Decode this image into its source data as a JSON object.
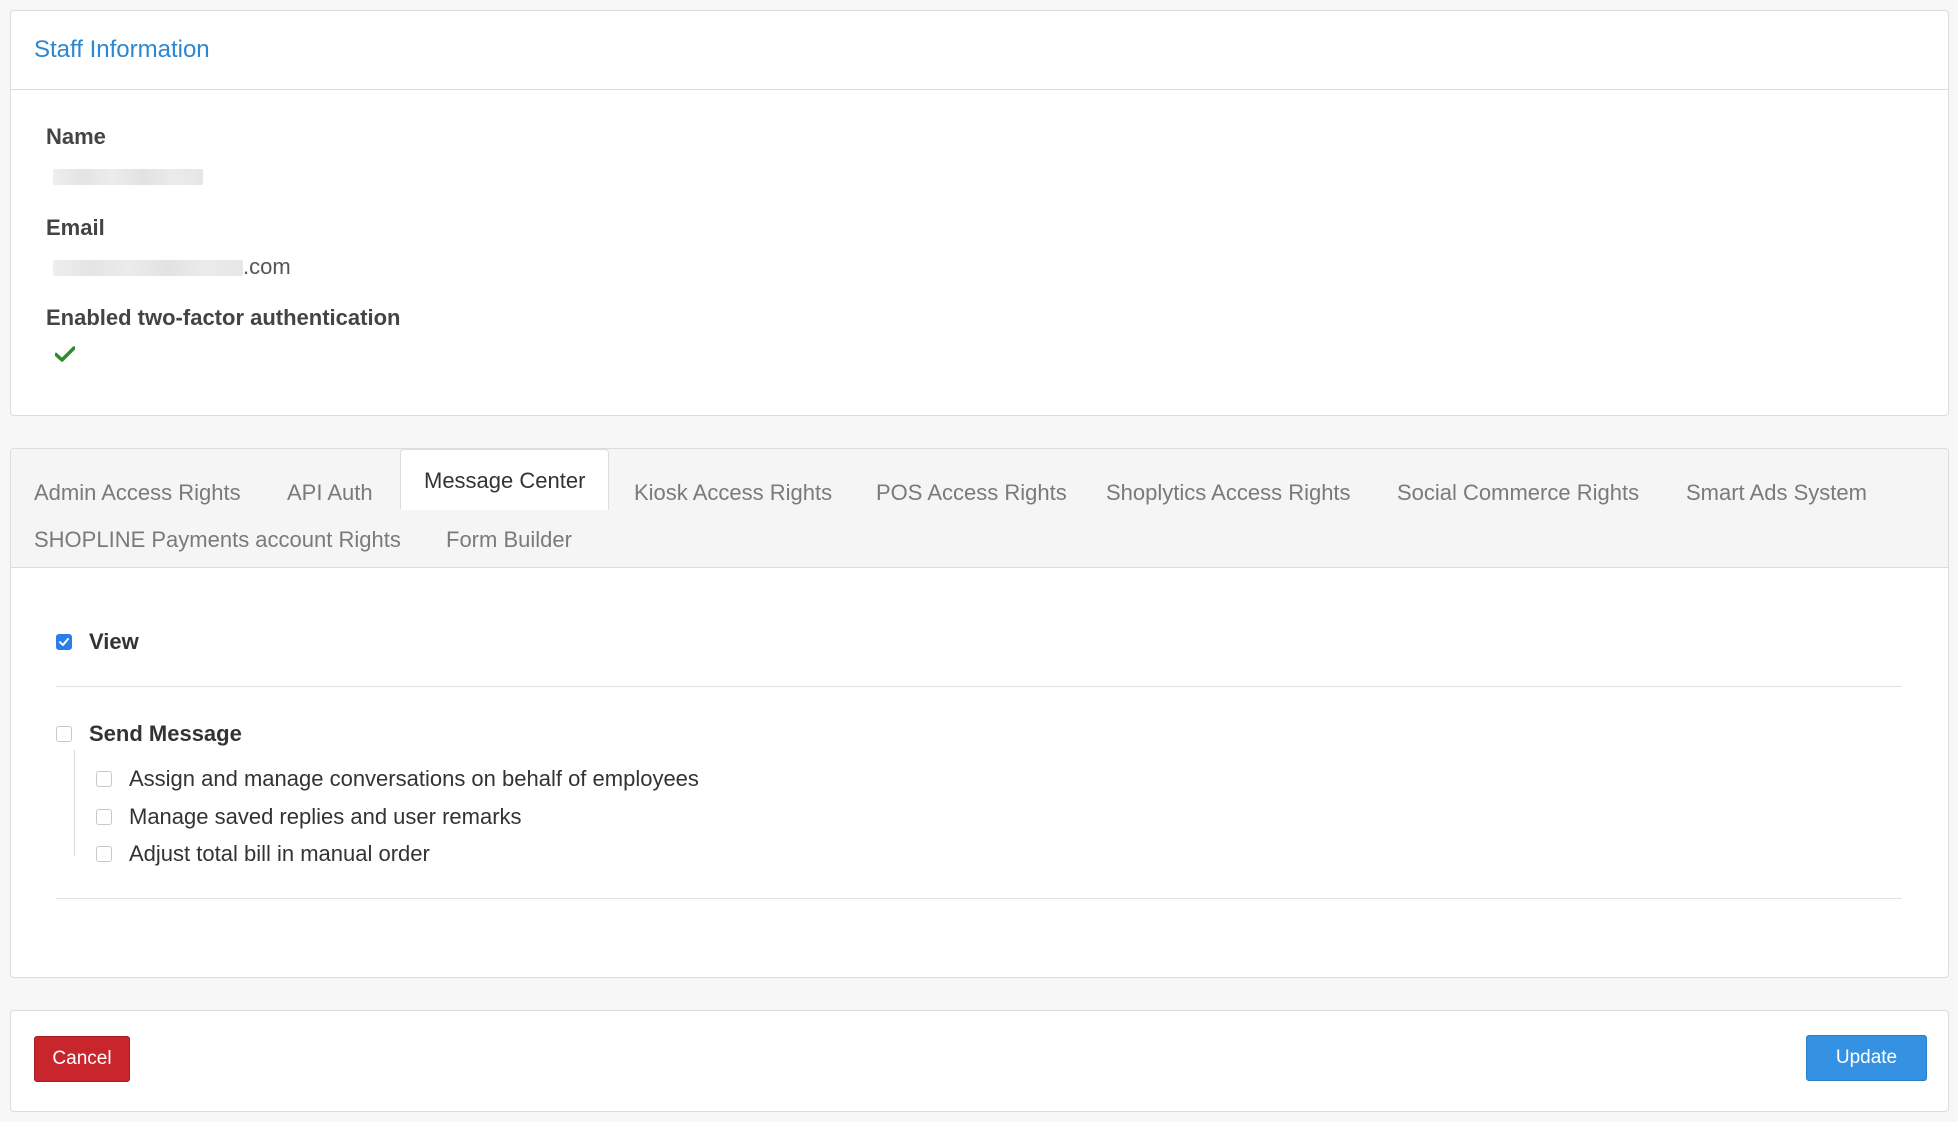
{
  "staff_info": {
    "title": "Staff Information",
    "name_label": "Name",
    "email_label": "Email",
    "email_suffix": ".com",
    "two_factor_label": "Enabled two-factor authentication",
    "two_factor_icon": "checkmark-icon",
    "two_factor_color": "#2e8b2e"
  },
  "tabs": [
    {
      "label": "Admin Access Rights"
    },
    {
      "label": "API Auth"
    },
    {
      "label": "Message Center"
    },
    {
      "label": "Kiosk Access Rights"
    },
    {
      "label": "POS Access Rights"
    },
    {
      "label": "Shoplytics Access Rights"
    },
    {
      "label": "Social Commerce Rights"
    },
    {
      "label": "Smart Ads System"
    },
    {
      "label": "SHOPLINE Payments account Rights"
    },
    {
      "label": "Form Builder"
    }
  ],
  "active_tab": "Message Center",
  "permissions": {
    "view": {
      "label": "View",
      "checked": true
    },
    "send_message": {
      "label": "Send Message",
      "checked": false,
      "sub_items": [
        {
          "label": "Assign and manage conversations on behalf of employees",
          "checked": false
        },
        {
          "label": "Manage saved replies and user remarks",
          "checked": false
        },
        {
          "label": "Adjust total bill in manual order",
          "checked": false
        }
      ]
    }
  },
  "footer": {
    "cancel_label": "Cancel",
    "update_label": "Update",
    "cancel_color": "#c8262c",
    "update_color": "#3592e2"
  }
}
